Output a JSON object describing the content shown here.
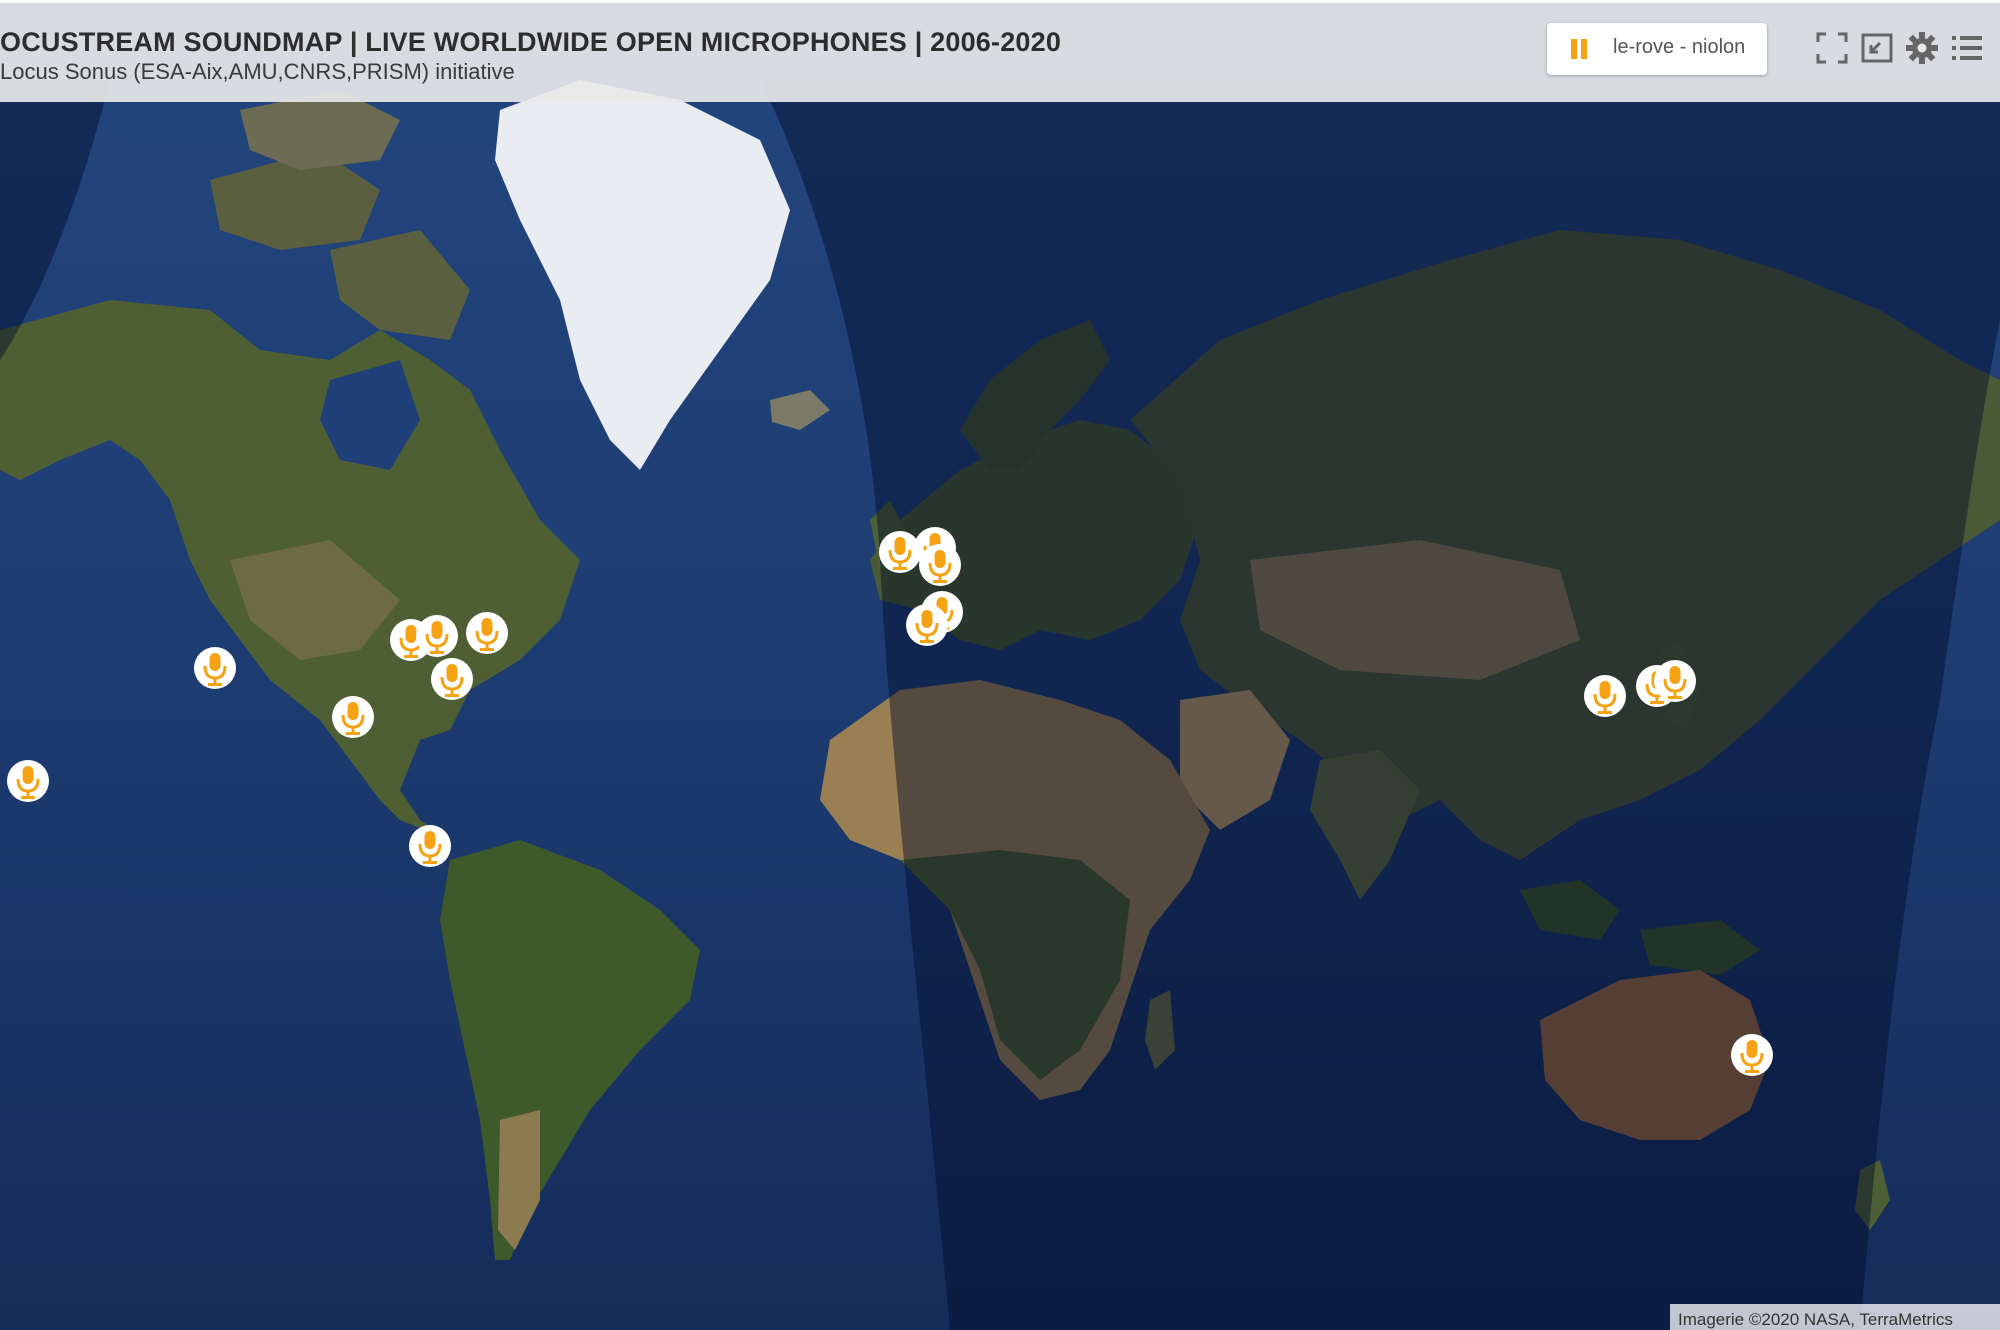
{
  "header": {
    "title": "OCUSTREAM SOUNDMAP | LIVE WORLDWIDE OPEN MICROPHONES | 2006-2020",
    "subtitle": "Locus Sonus (ESA-Aix,AMU,CNRS,PRISM) initiative"
  },
  "player": {
    "state_icon": "pause-icon",
    "now_playing": "le-rove - niolon",
    "accent": "#f5a215"
  },
  "toolbar": {
    "icons": [
      "fullscreen-icon",
      "exit-window-icon",
      "gear-icon",
      "list-icon"
    ]
  },
  "map": {
    "marker_icon": "microphone-icon",
    "marker_color": "#f5a215",
    "attribution": "Imagerie ©2020 NASA, TerraMetrics"
  }
}
